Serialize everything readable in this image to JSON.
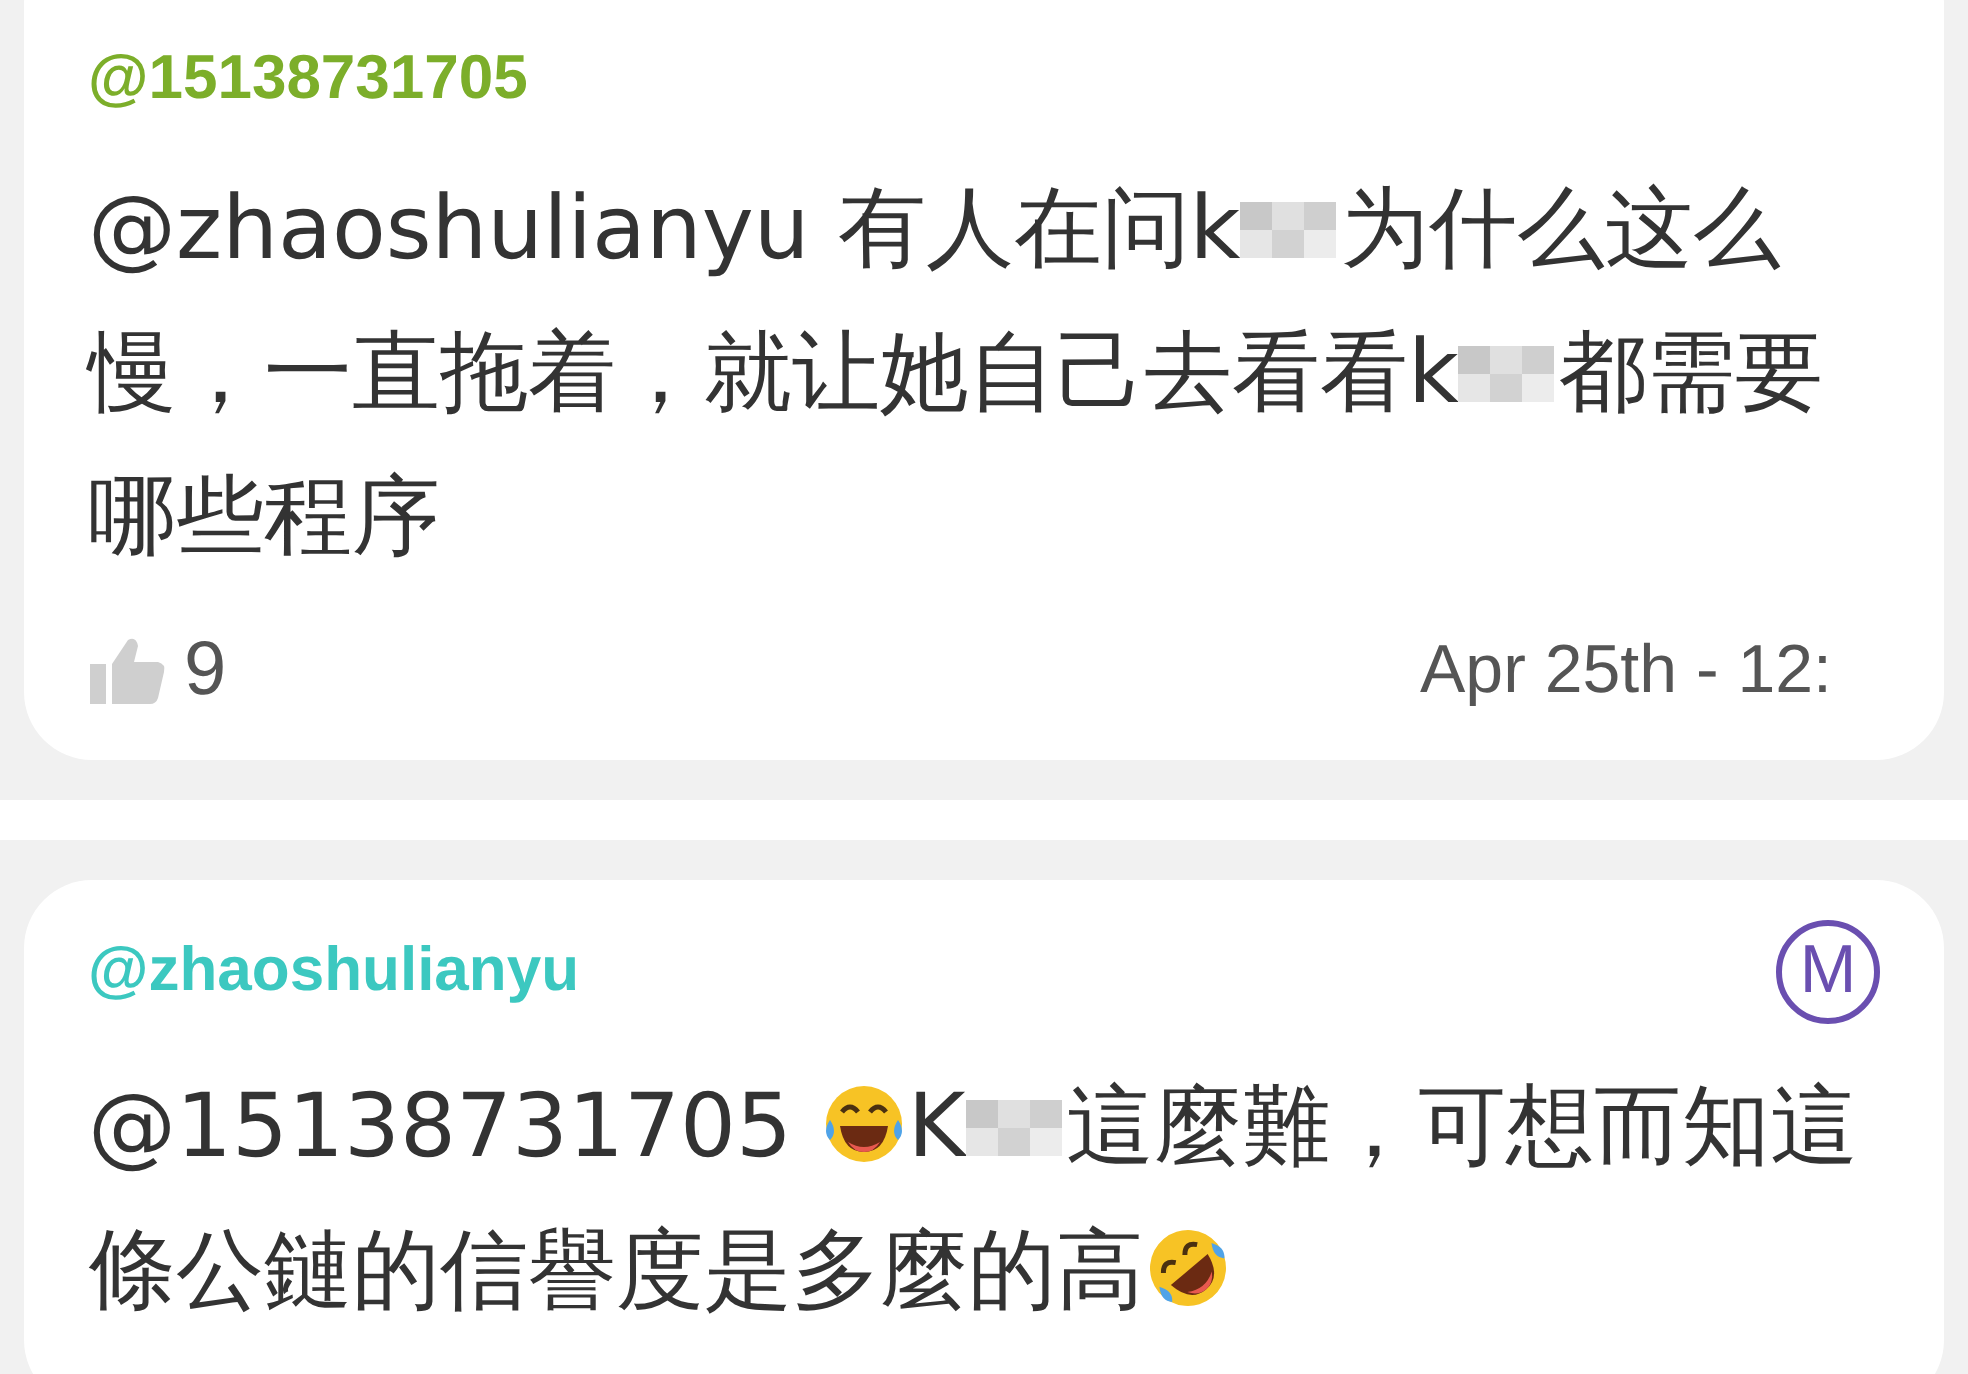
{
  "comments": [
    {
      "handle": "@15138731705",
      "color": "#7cae2a",
      "body": [
        {
          "kind": "text",
          "text": "@zhaoshulianyu 有人在问k"
        },
        {
          "kind": "blur"
        },
        {
          "kind": "text",
          "text": "为什么这么慢，一直拖着，就让她自己去看看k"
        },
        {
          "kind": "blur"
        },
        {
          "kind": "text",
          "text": "都需要哪些程序"
        }
      ],
      "likes": "9",
      "time": "Apr 25th - 12:"
    },
    {
      "handle": "@zhaoshulianyu",
      "color": "#3cc8c0",
      "badge": "M",
      "body": [
        {
          "kind": "text",
          "text": "@15138731705 "
        },
        {
          "kind": "joy"
        },
        {
          "kind": "text",
          "text": "K"
        },
        {
          "kind": "blur"
        },
        {
          "kind": "text",
          "text": "這麼難，可想而知這條公鏈的信譽度是多麼的高"
        },
        {
          "kind": "rofl"
        }
      ]
    }
  ]
}
